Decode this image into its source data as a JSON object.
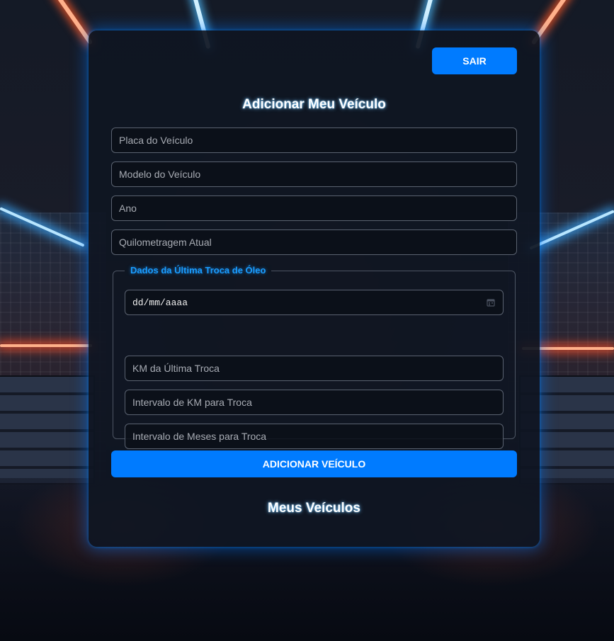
{
  "header": {
    "logout_label": "SAIR"
  },
  "form": {
    "title": "Adicionar Meu Veículo",
    "plate_placeholder": "Placa do Veículo",
    "model_placeholder": "Modelo do Veículo",
    "year_placeholder": "Ano",
    "mileage_placeholder": "Quilometragem Atual",
    "oil_change": {
      "legend": "Dados da Última Troca de Óleo",
      "date_placeholder": "dd/mm/aaaa",
      "last_km_placeholder": "KM da Última Troca",
      "km_interval_placeholder": "Intervalo de KM para Troca",
      "month_interval_placeholder": "Intervalo de Meses para Troca"
    },
    "submit_label": "ADICIONAR VEÍCULO"
  },
  "vehicles": {
    "title": "Meus Veículos"
  },
  "colors": {
    "accent": "#007bff",
    "legend": "#1a9dff",
    "card_glow": "#0078ff"
  },
  "icons": {
    "date_picker": "calendar-icon"
  }
}
